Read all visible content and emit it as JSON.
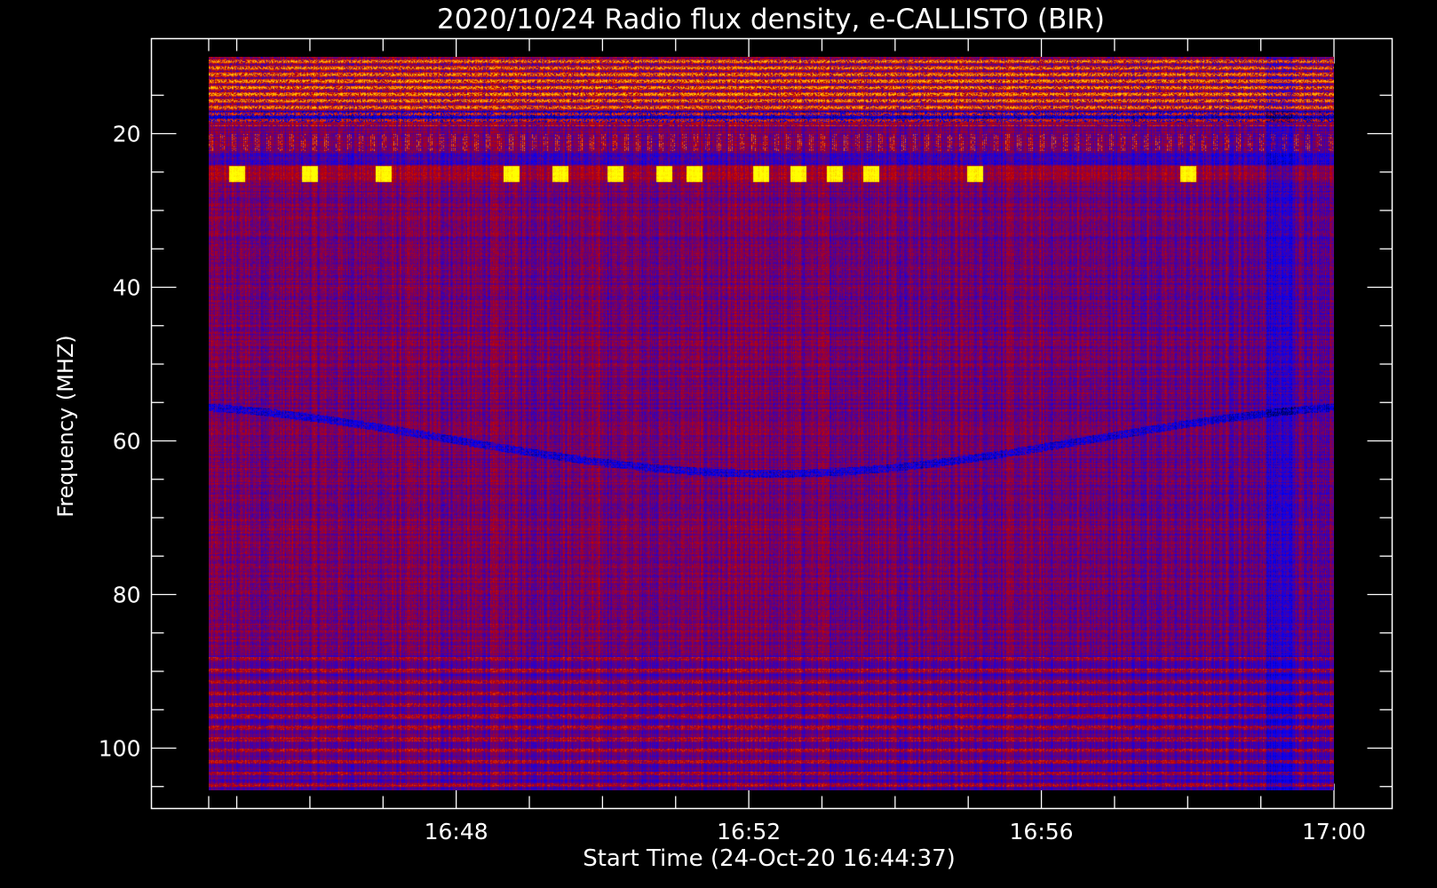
{
  "chart_data": {
    "type": "heatmap",
    "title": "2020/10/24  Radio flux density, e-CALLISTO (BIR)",
    "xlabel": "Start Time (24-Oct-20 16:44:37)",
    "ylabel": "Frequency (MHZ)",
    "x_start": "16:44:37",
    "x_end": "17:00:00",
    "xlim": [
      "16:44:37",
      "17:00:00"
    ],
    "ylim": [
      106,
      10
    ],
    "y_inverted": true,
    "x_ticks": [
      "16:48",
      "16:52",
      "16:56",
      "17:00"
    ],
    "y_ticks": [
      20,
      40,
      60,
      80,
      100
    ],
    "colormap": [
      "#000000",
      "#0000ff",
      "#c00000",
      "#ff6a00",
      "#ffff00"
    ],
    "features": [
      {
        "name": "rfi-band",
        "freq_range_mhz": [
          10,
          19
        ],
        "intensity": "high"
      },
      {
        "name": "rfi-band",
        "freq_range_mhz": [
          20,
          22
        ],
        "intensity": "medium"
      },
      {
        "name": "interference-blips",
        "freq_mhz": 25,
        "intensity": "high",
        "times": [
          "16:45:00",
          "16:46:00",
          "16:47:00",
          "16:48:45",
          "16:49:25",
          "16:50:10",
          "16:50:50",
          "16:51:15",
          "16:52:10",
          "16:52:40",
          "16:53:10",
          "16:53:40",
          "16:55:05",
          "16:58:00"
        ]
      },
      {
        "name": "curved-trace",
        "freq_mhz": 60,
        "intensity": "low"
      },
      {
        "name": "noise-band",
        "freq_range_mhz": [
          88,
          106
        ],
        "intensity": "medium"
      }
    ]
  }
}
